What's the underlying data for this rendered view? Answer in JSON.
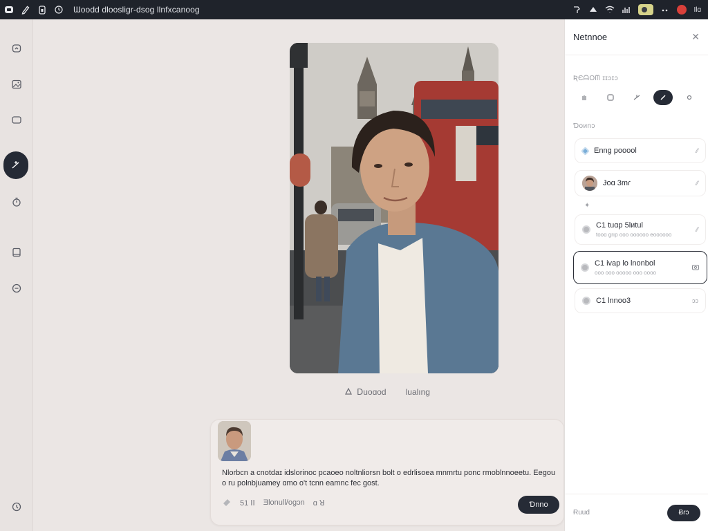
{
  "topbar": {
    "title": "Ɯoodd dloosligr-dsog llnfxcanoog",
    "status": "Ilɑ"
  },
  "rail": {
    "icons": [
      "home-icon",
      "gallery-icon",
      "screen-icon",
      "magic-wand-icon",
      "timer-icon",
      "book-icon",
      "history-icon",
      "info-icon"
    ]
  },
  "main": {
    "caption": {
      "left": "Ⅾuoɑod",
      "right": "lualıng"
    },
    "prompt": {
      "text": "Nlorbcn a cnotdaɪ idslorinoc pcaoeo noltnliorsn bolt o edrlisoea mnmrtu ponc rmoblnnoeetu. Eegou o ru polnbjuamey ɑmo o't tcnn eamnc fec gost.",
      "tools": [
        "51 ꓲꓲ",
        "Ǝlonull/ogɔn",
        "ɑ ꓤ"
      ],
      "generate_label": "Ɗnno"
    }
  },
  "panel": {
    "title": "Netnnoe",
    "section_tools": "ƦЄᗩOᗰ ɪɪɔɪɔ",
    "section_layers": "Ɗoᴎnɔ",
    "layers": [
      {
        "name": "Enng pooool",
        "sub": "",
        "meta": "⁄⁄"
      },
      {
        "name": "Ɉoɑ 3mɾ",
        "sub": "",
        "meta": "⁄⁄"
      },
      {
        "name": "C1 tuɑp 5lᴎtul",
        "sub": "tooɑ grıp ooo oooooo eoooooo",
        "meta": "⁄⁄"
      },
      {
        "name": "C1 ivap lo lnonbol",
        "sub": "ooo ooo ooooo ooo oooo",
        "meta": ""
      },
      {
        "name": "C1 lnnoo3",
        "sub": "",
        "meta": "ɔɔ"
      }
    ],
    "footer_text": "Ɍuud",
    "apply_label": "Ƀɾɔ"
  }
}
